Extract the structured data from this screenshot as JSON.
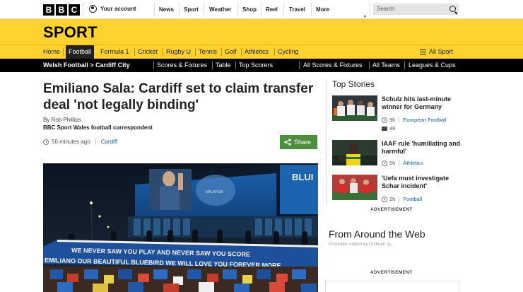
{
  "global_bar": {
    "logo_letters": [
      "B",
      "B",
      "C"
    ],
    "account_label": "Your account",
    "nav": [
      "News",
      "Sport",
      "Weather",
      "Shop",
      "Reel",
      "Travel"
    ],
    "more_label": "More",
    "search_placeholder": "Search"
  },
  "sport": {
    "title": "SPORT",
    "nav": [
      "Home",
      "Football",
      "Formula 1",
      "Cricket",
      "Rugby U",
      "Tennis",
      "Golf",
      "Athletics",
      "Cycling"
    ],
    "active": "Football",
    "all_sport_label": "All Sport"
  },
  "subnav": {
    "breadcrumb": "Welsh Football > Cardiff City",
    "left_links": [
      "Scores & Fixtures",
      "Table",
      "Top Scorers"
    ],
    "right_links": [
      "All Scores & Fixtures",
      "All Teams",
      "Leagues & Cups"
    ]
  },
  "article": {
    "headline": "Emiliano Sala: Cardiff set to claim transfer deal 'not legally binding'",
    "byline_name": "By Rob Phillips",
    "byline_role": "BBC Sport Wales football correspondent",
    "time": "50 minutes ago",
    "category": "Cardiff",
    "share_label": "Share",
    "image": {
      "banner_line1": "WE NEVER SAW YOU PLAY AND NEVER SAW YOU SCORE",
      "banner_line2": "EMILIANO OUR BEAUTIFUL BLUEBIRD WE WILL LOVE YOU FOREVER MORE",
      "stadium_text": "BLUI",
      "sign_text": "MALAYSIA"
    }
  },
  "sidebar": {
    "top_stories_heading": "Top Stories",
    "stories": [
      {
        "title": "Schulz hits last-minute winner for Germany",
        "time": "9h",
        "category": "European Football",
        "comments": "46"
      },
      {
        "title": "IAAF rule 'humiliating and harmful'",
        "time": "5h",
        "category": "Athletics"
      },
      {
        "title": "'Uefa must investigate Schar incident'",
        "time": "2h",
        "category": "Football"
      }
    ],
    "advertisement_label_1": "ADVERTISEMENT",
    "from_web_heading": "From Around the Web",
    "promoted_text": "Promoted content by Outbrain",
    "advertisement_label_2": "ADVERTISEMENT"
  },
  "colors": {
    "sport_yellow": "#ffd230",
    "share_green": "#4b8e3d",
    "link_blue": "#1a5d9c"
  }
}
